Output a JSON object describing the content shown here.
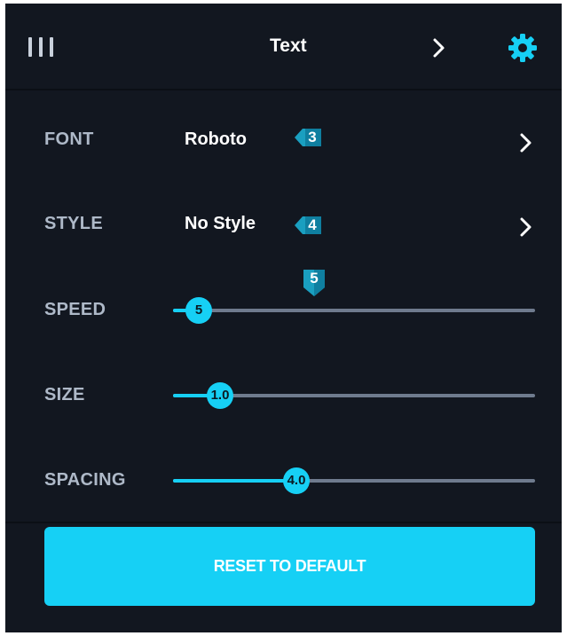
{
  "header": {
    "title": "Text",
    "menu_icon": "menu-bars-icon",
    "next_icon": "chevron-right-icon",
    "settings_icon": "gear-icon"
  },
  "rows": {
    "font": {
      "label": "FONT",
      "value": "Roboto",
      "callout": "3"
    },
    "style": {
      "label": "STYLE",
      "value": "No Style",
      "callout": "4"
    }
  },
  "sliders": {
    "callout": "5",
    "speed": {
      "label": "SPEED",
      "value": "5",
      "fraction": 0.07
    },
    "size": {
      "label": "SIZE",
      "value": "1.0",
      "fraction": 0.13
    },
    "spacing": {
      "label": "SPACING",
      "value": "4.0",
      "fraction": 0.34
    }
  },
  "reset": {
    "label": "RESET TO DEFAULT"
  },
  "colors": {
    "accent": "#16d0f5",
    "background": "#121720",
    "label": "#aeb9c8",
    "track": "#6f7b8e",
    "callout": "#1a9fc0"
  }
}
